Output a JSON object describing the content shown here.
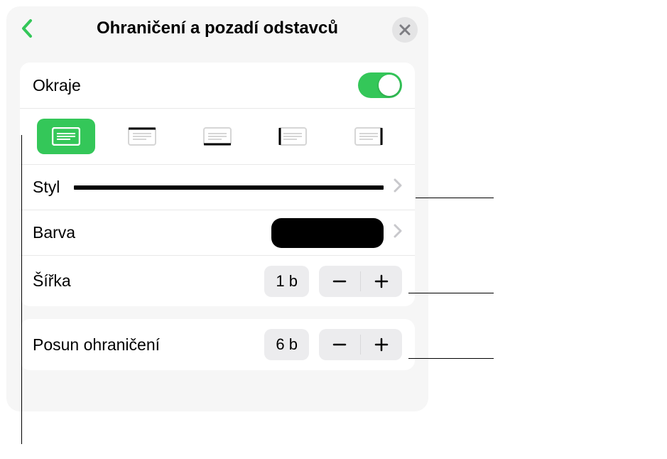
{
  "header": {
    "title": "Ohraničení a pozadí odstavců"
  },
  "margins": {
    "label": "Okraje",
    "enabled": true
  },
  "style": {
    "label": "Styl"
  },
  "color": {
    "label": "Barva",
    "swatch": "#000000"
  },
  "width": {
    "label": "Šířka",
    "value": "1 b"
  },
  "offset": {
    "label": "Posun ohraničení",
    "value": "6 b"
  },
  "accent": "#34c759"
}
